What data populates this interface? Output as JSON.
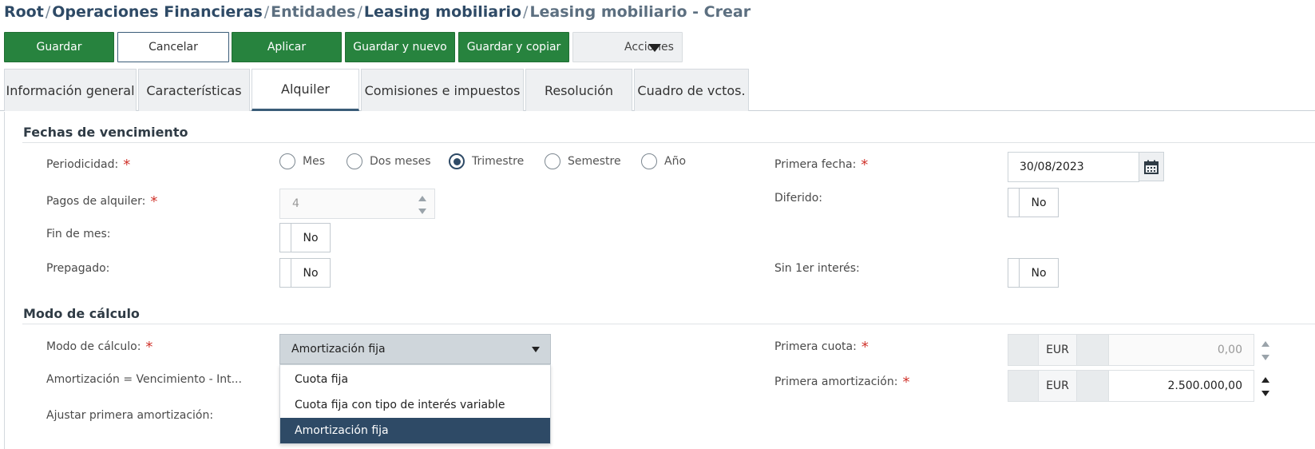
{
  "breadcrumb": {
    "items": [
      "Root",
      "Operaciones Financieras",
      "Entidades",
      "Leasing mobiliario",
      "Leasing mobiliario - Crear"
    ]
  },
  "toolbar": {
    "guardar": "Guardar",
    "cancelar": "Cancelar",
    "aplicar": "Aplicar",
    "guardar_nuevo": "Guardar y nuevo",
    "guardar_copiar": "Guardar y copiar",
    "acciones": "Acciones"
  },
  "tabs": [
    {
      "label": "Información general",
      "active": false
    },
    {
      "label": "Características",
      "active": false
    },
    {
      "label": "Alquiler",
      "active": true
    },
    {
      "label": "Comisiones e impuestos",
      "active": false
    },
    {
      "label": "Resolución",
      "active": false
    },
    {
      "label": "Cuadro de vctos.",
      "active": false
    }
  ],
  "fechas": {
    "title": "Fechas de vencimiento",
    "periodicidad_label": "Periodicidad:",
    "periodicidad_options": [
      "Mes",
      "Dos meses",
      "Trimestre",
      "Semestre",
      "Año"
    ],
    "periodicidad_selected": "Trimestre",
    "pagos_label": "Pagos de alquiler:",
    "pagos_value": "4",
    "fin_mes_label": "Fin de mes:",
    "fin_mes_value": "No",
    "prepagado_label": "Prepagado:",
    "prepagado_value": "No",
    "primera_fecha_label": "Primera fecha:",
    "primera_fecha_value": "30/08/2023",
    "diferido_label": "Diferido:",
    "diferido_value": "No",
    "sin_interes_label": "Sin 1er interés:",
    "sin_interes_value": "No"
  },
  "modo": {
    "title": "Modo de cálculo",
    "modo_label": "Modo de cálculo:",
    "modo_value": "Amortización fija",
    "modo_options": [
      "Cuota fija",
      "Cuota fija con tipo de interés variable",
      "Amortización fija"
    ],
    "amortizacion_label": "Amortización = Vencimiento - Int...",
    "ajustar_label": "Ajustar primera amortización:",
    "primera_cuota_label": "Primera cuota:",
    "primera_cuota_currency": "EUR",
    "primera_cuota_value": "0,00",
    "primera_amort_label": "Primera amortización:",
    "primera_amort_currency": "EUR",
    "primera_amort_value": "2.500.000,00"
  },
  "required_mark": "*"
}
